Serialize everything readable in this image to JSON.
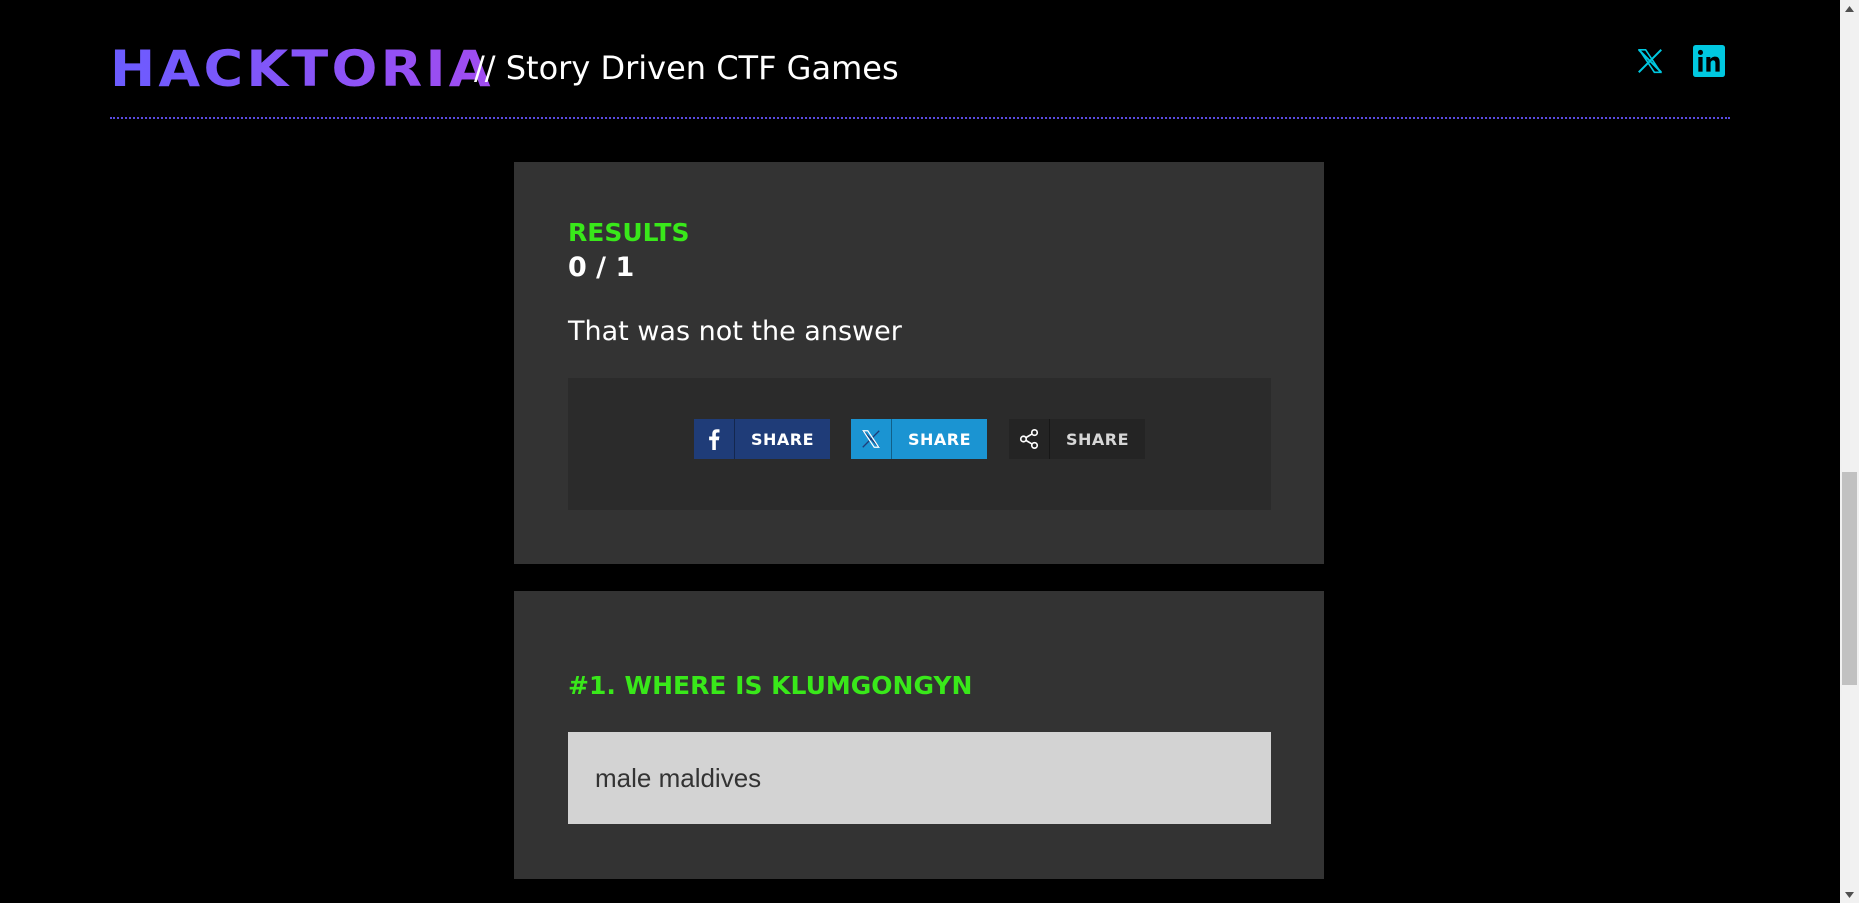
{
  "header": {
    "logo_text": "HACKTORIA",
    "tagline": "// Story Driven CTF Games",
    "social": [
      {
        "icon": "x-twitter-icon",
        "color": "#00c8e0"
      },
      {
        "icon": "linkedin-icon",
        "color": "#00c8e0"
      }
    ]
  },
  "results": {
    "label": "RESULTS",
    "score": "0 / 1",
    "message": "That was not the answer",
    "share_buttons": [
      {
        "network": "facebook",
        "icon": "facebook-icon",
        "label": "SHARE",
        "color": "#1f3c78"
      },
      {
        "network": "x",
        "icon": "x-twitter-icon",
        "label": "SHARE",
        "color": "#1b94d2"
      },
      {
        "network": "generic",
        "icon": "share-icon",
        "label": "SHARE",
        "color": "#242424"
      }
    ]
  },
  "question": {
    "title": "#1. WHERE IS KLUMGONGYN",
    "answer": "male maldives"
  },
  "colors": {
    "accent_green": "#39e81a",
    "card_bg": "#333333",
    "page_bg": "#000000",
    "logo_purple": "#8a5cf5"
  }
}
